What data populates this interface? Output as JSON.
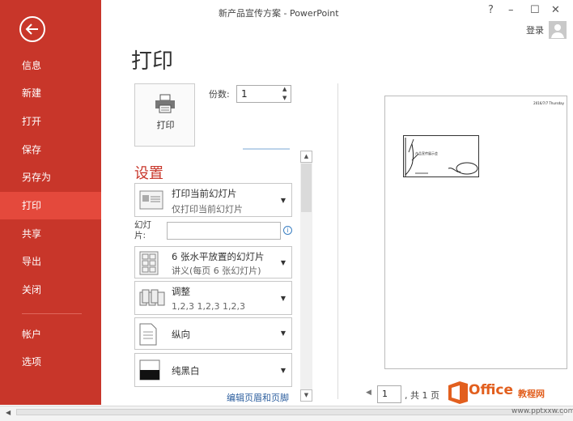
{
  "window": {
    "title": "新产品宣传方案 - PowerPoint",
    "help": "?",
    "minimize": "–",
    "restore": "☐",
    "close": "✕",
    "signin": "登录"
  },
  "sidebar": {
    "items": [
      {
        "label": "信息"
      },
      {
        "label": "新建"
      },
      {
        "label": "打开"
      },
      {
        "label": "保存"
      },
      {
        "label": "另存为"
      },
      {
        "label": "打印",
        "active": true
      },
      {
        "label": "共享"
      },
      {
        "label": "导出"
      },
      {
        "label": "关闭"
      },
      {
        "label": "帐户"
      },
      {
        "label": "选项"
      }
    ]
  },
  "page_title": "打印",
  "print": {
    "button_label": "打印",
    "copies_label": "份数:",
    "copies_value": "1"
  },
  "settings": {
    "heading": "设置",
    "slides_range": {
      "title": "打印当前幻灯片",
      "sub": "仅打印当前幻灯片"
    },
    "slides_label": "幻灯片:",
    "layout": {
      "title": "6 张水平放置的幻灯片",
      "sub": "讲义(每页 6 张幻灯片)"
    },
    "collate": {
      "title": "调整",
      "sub": "1,2,3    1,2,3    1,2,3"
    },
    "orientation": {
      "title": "纵向"
    },
    "color": {
      "title": "纯黑白"
    },
    "edit_header_footer": "编辑页眉和页脚"
  },
  "preview": {
    "date": "2016/7/7 Thursday",
    "slide_text": "产品宣传展示会",
    "page_current": "1",
    "page_total": ", 共 1 页"
  },
  "watermark": {
    "logo": "Office",
    "brand": "教程网",
    "url": "www.pptxxw.com"
  },
  "colors": {
    "accent": "#c8362a",
    "accent_active": "#e4493c"
  }
}
